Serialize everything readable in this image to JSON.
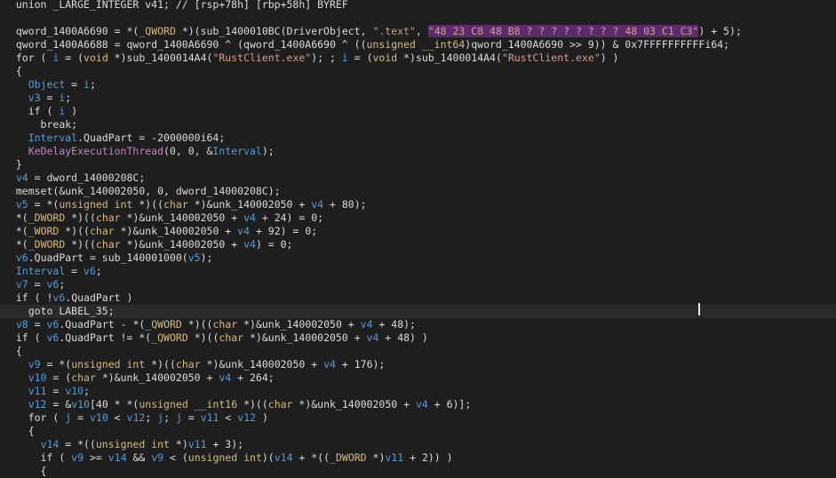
{
  "editor": {
    "lines": [
      {
        "indent": 2,
        "segs": [
          [
            "pl",
            "union _LARGE_INTEGER v41; // [rsp+78h] [rbp+58h] BYREF"
          ]
        ]
      },
      {
        "indent": 0,
        "segs": []
      },
      {
        "indent": 2,
        "segs": [
          [
            "pl",
            "qword_1400A6690 = *("
          ],
          [
            "ty",
            "_QWORD"
          ],
          [
            "pl",
            " *)(sub_1400010BC(DriverObject, "
          ],
          [
            "st",
            "\".text\""
          ],
          [
            "pl",
            ", "
          ],
          [
            "sh",
            "\"48 23 C8 48 B8 ? ? ? ? ? ? ? ? 48 03 C1 C3\""
          ],
          [
            "pl",
            ") + 5);"
          ]
        ]
      },
      {
        "indent": 2,
        "segs": [
          [
            "pl",
            "qword_1400A6688 = qword_1400A6690 ^ (qword_1400A6690 ^ (("
          ],
          [
            "ty",
            "unsigned __int64"
          ],
          [
            "pl",
            ")qword_1400A6690 >> 9)) & 0x7FFFFFFFFFFi64;"
          ]
        ]
      },
      {
        "indent": 2,
        "segs": [
          [
            "pl",
            "for ( "
          ],
          [
            "vr",
            "i"
          ],
          [
            "pl",
            " = ("
          ],
          [
            "ty",
            "void"
          ],
          [
            "pl",
            " *)sub_1400014A4("
          ],
          [
            "st",
            "\"RustClient.exe\""
          ],
          [
            "pl",
            "); ; "
          ],
          [
            "vr",
            "i"
          ],
          [
            "pl",
            " = ("
          ],
          [
            "ty",
            "void"
          ],
          [
            "pl",
            " *)sub_1400014A4("
          ],
          [
            "st",
            "\"RustClient.exe\""
          ],
          [
            "pl",
            ") )"
          ]
        ]
      },
      {
        "indent": 2,
        "segs": [
          [
            "pl",
            "{"
          ]
        ]
      },
      {
        "indent": 4,
        "segs": [
          [
            "vr",
            "Object"
          ],
          [
            "pl",
            " = "
          ],
          [
            "vr",
            "i"
          ],
          [
            "pl",
            ";"
          ]
        ]
      },
      {
        "indent": 4,
        "segs": [
          [
            "vr",
            "v3"
          ],
          [
            "pl",
            " = "
          ],
          [
            "vr",
            "i"
          ],
          [
            "pl",
            ";"
          ]
        ]
      },
      {
        "indent": 4,
        "segs": [
          [
            "pl",
            "if ( "
          ],
          [
            "vr",
            "i"
          ],
          [
            "pl",
            " )"
          ]
        ]
      },
      {
        "indent": 6,
        "segs": [
          [
            "pl",
            "break;"
          ]
        ]
      },
      {
        "indent": 4,
        "segs": [
          [
            "vr",
            "Interval"
          ],
          [
            "pl",
            ".QuadPart = -2000000i64;"
          ]
        ]
      },
      {
        "indent": 4,
        "segs": [
          [
            "kf",
            "KeDelayExecutionThread"
          ],
          [
            "pl",
            "(0, 0, &"
          ],
          [
            "vr",
            "Interval"
          ],
          [
            "pl",
            ");"
          ]
        ]
      },
      {
        "indent": 2,
        "segs": [
          [
            "pl",
            "}"
          ]
        ]
      },
      {
        "indent": 2,
        "segs": [
          [
            "vr",
            "v4"
          ],
          [
            "pl",
            " = dword_14000208C;"
          ]
        ]
      },
      {
        "indent": 2,
        "segs": [
          [
            "pl",
            "memset(&unk_140002050, 0, dword_14000208C);"
          ]
        ]
      },
      {
        "indent": 2,
        "segs": [
          [
            "vr",
            "v5"
          ],
          [
            "pl",
            " = *("
          ],
          [
            "ty",
            "unsigned int"
          ],
          [
            "pl",
            " *)(("
          ],
          [
            "ty",
            "char"
          ],
          [
            "pl",
            " *)&unk_140002050 + "
          ],
          [
            "vr",
            "v4"
          ],
          [
            "pl",
            " + 80);"
          ]
        ]
      },
      {
        "indent": 2,
        "segs": [
          [
            "pl",
            "*("
          ],
          [
            "ty",
            "_DWORD"
          ],
          [
            "pl",
            " *)(("
          ],
          [
            "ty",
            "char"
          ],
          [
            "pl",
            " *)&unk_140002050 + "
          ],
          [
            "vr",
            "v4"
          ],
          [
            "pl",
            " + 24) = 0;"
          ]
        ]
      },
      {
        "indent": 2,
        "segs": [
          [
            "pl",
            "*("
          ],
          [
            "ty",
            "_WORD"
          ],
          [
            "pl",
            " *)(("
          ],
          [
            "ty",
            "char"
          ],
          [
            "pl",
            " *)&unk_140002050 + "
          ],
          [
            "vr",
            "v4"
          ],
          [
            "pl",
            " + 92) = 0;"
          ]
        ]
      },
      {
        "indent": 2,
        "segs": [
          [
            "pl",
            "*("
          ],
          [
            "ty",
            "_DWORD"
          ],
          [
            "pl",
            " *)(("
          ],
          [
            "ty",
            "char"
          ],
          [
            "pl",
            " *)&unk_140002050 + "
          ],
          [
            "vr",
            "v4"
          ],
          [
            "pl",
            ") = 0;"
          ]
        ]
      },
      {
        "indent": 2,
        "segs": [
          [
            "vr",
            "v6"
          ],
          [
            "pl",
            ".QuadPart = sub_140001000("
          ],
          [
            "vr",
            "v5"
          ],
          [
            "pl",
            ");"
          ]
        ]
      },
      {
        "indent": 2,
        "segs": [
          [
            "vr",
            "Interval"
          ],
          [
            "pl",
            " = "
          ],
          [
            "vr",
            "v6"
          ],
          [
            "pl",
            ";"
          ]
        ]
      },
      {
        "indent": 2,
        "segs": [
          [
            "vr",
            "v7"
          ],
          [
            "pl",
            " = "
          ],
          [
            "vr",
            "v6"
          ],
          [
            "pl",
            ";"
          ]
        ]
      },
      {
        "indent": 2,
        "segs": [
          [
            "pl",
            "if ( !"
          ],
          [
            "vr",
            "v6"
          ],
          [
            "pl",
            ".QuadPart )"
          ]
        ]
      },
      {
        "indent": 4,
        "hl": true,
        "segs": [
          [
            "pl",
            "goto LABEL_35;"
          ]
        ]
      },
      {
        "indent": 2,
        "segs": [
          [
            "vr",
            "v8"
          ],
          [
            "pl",
            " = "
          ],
          [
            "vr",
            "v6"
          ],
          [
            "pl",
            ".QuadPart - *("
          ],
          [
            "ty",
            "_QWORD"
          ],
          [
            "pl",
            " *)(("
          ],
          [
            "ty",
            "char"
          ],
          [
            "pl",
            " *)&unk_140002050 + "
          ],
          [
            "vr",
            "v4"
          ],
          [
            "pl",
            " + 48);"
          ]
        ]
      },
      {
        "indent": 2,
        "segs": [
          [
            "pl",
            "if ( "
          ],
          [
            "vr",
            "v6"
          ],
          [
            "pl",
            ".QuadPart != *("
          ],
          [
            "ty",
            "_QWORD"
          ],
          [
            "pl",
            " *)(("
          ],
          [
            "ty",
            "char"
          ],
          [
            "pl",
            " *)&unk_140002050 + "
          ],
          [
            "vr",
            "v4"
          ],
          [
            "pl",
            " + 48) )"
          ]
        ]
      },
      {
        "indent": 2,
        "segs": [
          [
            "pl",
            "{"
          ]
        ]
      },
      {
        "indent": 4,
        "segs": [
          [
            "vr",
            "v9"
          ],
          [
            "pl",
            " = *("
          ],
          [
            "ty",
            "unsigned int"
          ],
          [
            "pl",
            " *)(("
          ],
          [
            "ty",
            "char"
          ],
          [
            "pl",
            " *)&unk_140002050 + "
          ],
          [
            "vr",
            "v4"
          ],
          [
            "pl",
            " + 176);"
          ]
        ]
      },
      {
        "indent": 4,
        "segs": [
          [
            "vr",
            "v10"
          ],
          [
            "pl",
            " = ("
          ],
          [
            "ty",
            "char"
          ],
          [
            "pl",
            " *)&unk_140002050 + "
          ],
          [
            "vr",
            "v4"
          ],
          [
            "pl",
            " + 264;"
          ]
        ]
      },
      {
        "indent": 4,
        "segs": [
          [
            "vr",
            "v11"
          ],
          [
            "pl",
            " = "
          ],
          [
            "vr",
            "v10"
          ],
          [
            "pl",
            ";"
          ]
        ]
      },
      {
        "indent": 4,
        "segs": [
          [
            "vr",
            "v12"
          ],
          [
            "pl",
            " = &"
          ],
          [
            "vr",
            "v10"
          ],
          [
            "pl",
            "[40 * *("
          ],
          [
            "ty",
            "unsigned __int16"
          ],
          [
            "pl",
            " *)(("
          ],
          [
            "ty",
            "char"
          ],
          [
            "pl",
            " *)&unk_140002050 + "
          ],
          [
            "vr",
            "v4"
          ],
          [
            "pl",
            " + 6)];"
          ]
        ]
      },
      {
        "indent": 4,
        "segs": [
          [
            "pl",
            "for ( "
          ],
          [
            "vr",
            "j"
          ],
          [
            "pl",
            " = "
          ],
          [
            "vr",
            "v10"
          ],
          [
            "pl",
            " < "
          ],
          [
            "vr",
            "v12"
          ],
          [
            "pl",
            "; "
          ],
          [
            "vr",
            "j"
          ],
          [
            "pl",
            "; "
          ],
          [
            "vr",
            "j"
          ],
          [
            "pl",
            " = "
          ],
          [
            "vr",
            "v11"
          ],
          [
            "pl",
            " < "
          ],
          [
            "vr",
            "v12"
          ],
          [
            "pl",
            " )"
          ]
        ]
      },
      {
        "indent": 4,
        "segs": [
          [
            "pl",
            "{"
          ]
        ]
      },
      {
        "indent": 6,
        "segs": [
          [
            "vr",
            "v14"
          ],
          [
            "pl",
            " = *(("
          ],
          [
            "ty",
            "unsigned int"
          ],
          [
            "pl",
            " *)"
          ],
          [
            "vr",
            "v11"
          ],
          [
            "pl",
            " + 3);"
          ]
        ]
      },
      {
        "indent": 6,
        "segs": [
          [
            "pl",
            "if ( "
          ],
          [
            "vr",
            "v9"
          ],
          [
            "pl",
            " >= "
          ],
          [
            "vr",
            "v14"
          ],
          [
            "pl",
            " && "
          ],
          [
            "vr",
            "v9"
          ],
          [
            "pl",
            " < ("
          ],
          [
            "ty",
            "unsigned int"
          ],
          [
            "pl",
            ")("
          ],
          [
            "vr",
            "v14"
          ],
          [
            "pl",
            " + *(("
          ],
          [
            "ty",
            "_DWORD"
          ],
          [
            "pl",
            " *)"
          ],
          [
            "vr",
            "v11"
          ],
          [
            "pl",
            " + 2)) )"
          ]
        ]
      },
      {
        "indent": 6,
        "segs": [
          [
            "pl",
            "{"
          ]
        ]
      }
    ]
  }
}
